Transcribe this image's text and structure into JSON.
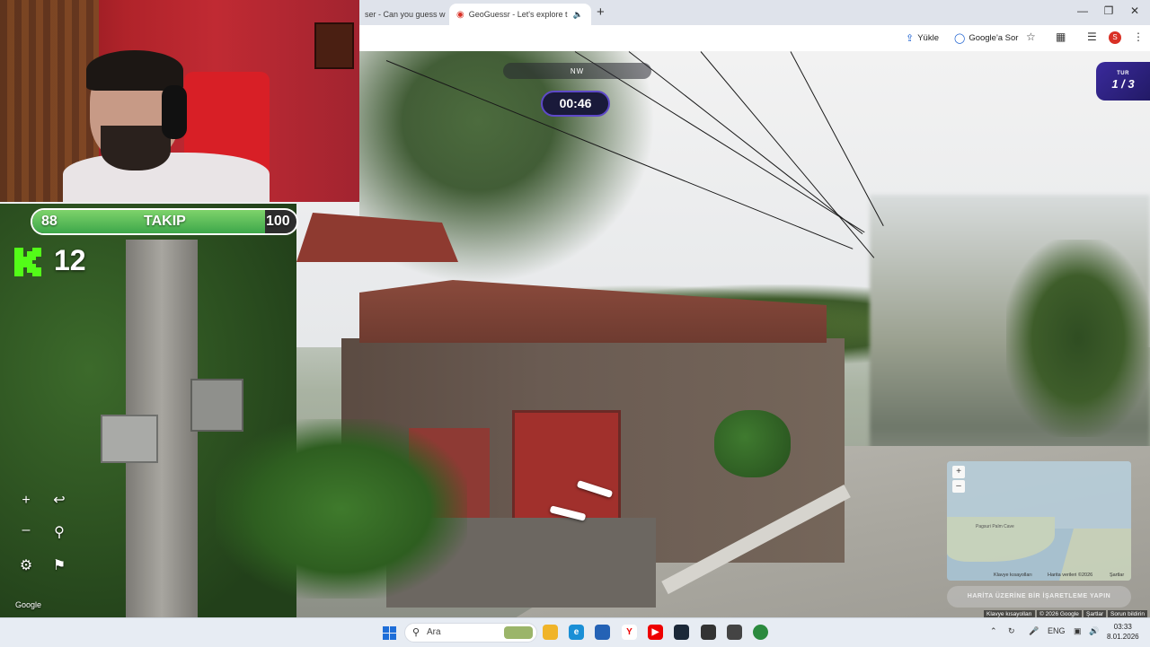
{
  "browser": {
    "tabs": [
      {
        "label": "ser - Can you guess w",
        "active": false
      },
      {
        "label": "GeoGuessr - Let's explore t",
        "active": true
      }
    ],
    "toolbar": {
      "upload_label": "Yükle",
      "google_ask_label": "Google'a Sor",
      "profile_initial": "S"
    }
  },
  "overlay": {
    "follow": {
      "current": "88",
      "label": "TAKIP",
      "goal": "100",
      "progress_fraction": 0.88
    },
    "k_count": "12"
  },
  "hud": {
    "compass": "NW",
    "timer": "00:46",
    "round": {
      "label": "TUR",
      "value": "1 / 3"
    },
    "google_label": "Google"
  },
  "minimap": {
    "place_label": "Pagsuri Palm Cave",
    "keyboard_shortcuts": "Klavye kısayolları",
    "map_data": "Harita verileri ©2026",
    "terms": "Şartlar",
    "guess_button": "HARİTA ÜZERİNE BİR İŞARETLEME YAPIN"
  },
  "streetview_footer": {
    "keyboard_shortcuts": "Klavye kısayolları",
    "copyright": "© 2026 Google",
    "terms": "Şartlar",
    "report": "Sorun bildirin"
  },
  "taskbar": {
    "search_placeholder": "Ara",
    "language": "ENG",
    "time": "03:33",
    "date": "8.01.2026"
  },
  "colors": {
    "follow_fill": "#4fbf52",
    "timer_border": "#5e49c8",
    "round_panel": "#2e2288"
  }
}
